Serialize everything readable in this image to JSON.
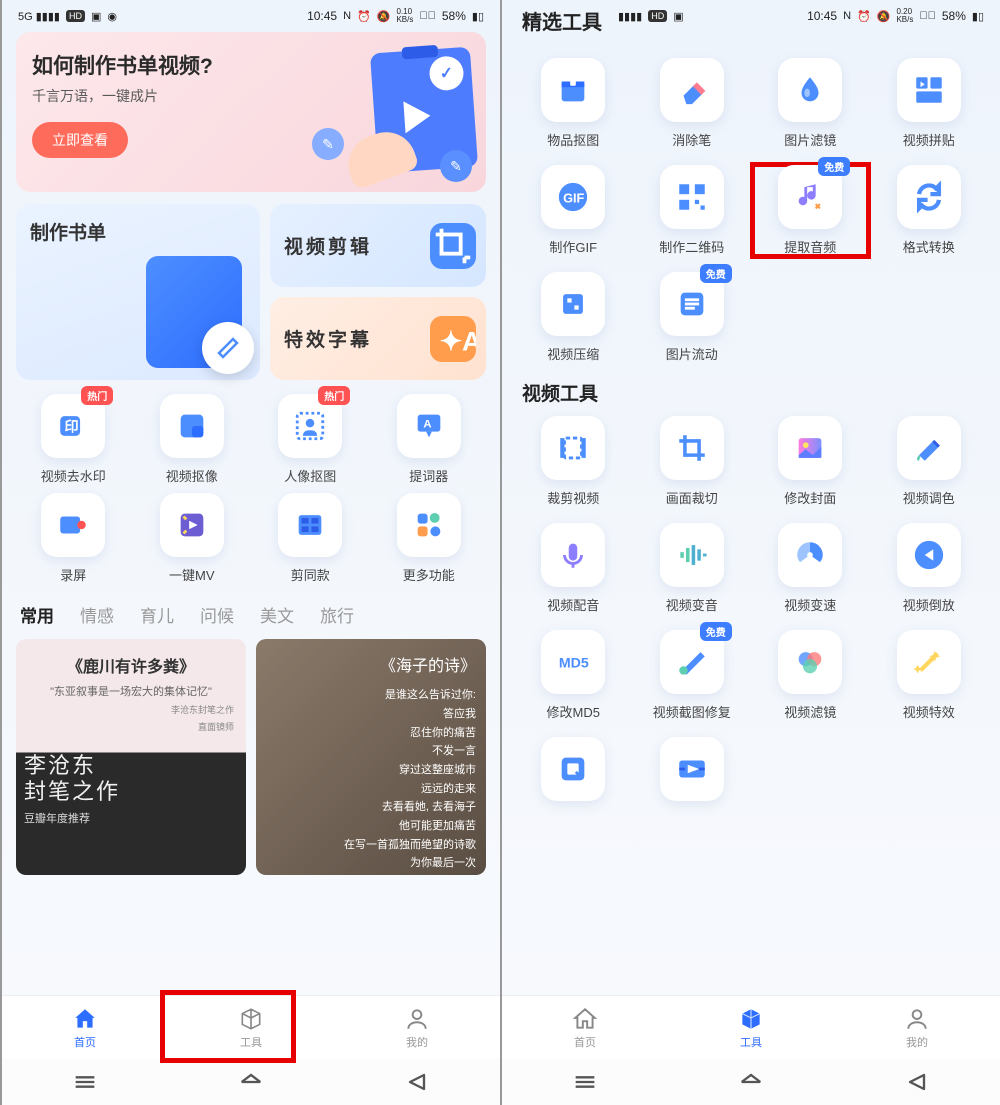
{
  "status": {
    "time": "10:45",
    "net_speed": "0.10",
    "net_unit": "KB/s",
    "battery": "58%",
    "net_speed2": "0.20"
  },
  "left": {
    "banner": {
      "title": "如何制作书单视频?",
      "sub": "千言万语，一键成片",
      "cta": "立即查看"
    },
    "big_card": "制作书单",
    "side_cards": [
      {
        "label": "视频剪辑"
      },
      {
        "label": "特效字幕"
      }
    ],
    "tools": [
      {
        "label": "视频去水印",
        "badge": "热门",
        "icon": "watermark"
      },
      {
        "label": "视频抠像",
        "icon": "cutout"
      },
      {
        "label": "人像抠图",
        "badge": "热门",
        "icon": "portrait"
      },
      {
        "label": "提词器",
        "icon": "teleprompter"
      },
      {
        "label": "录屏",
        "icon": "record"
      },
      {
        "label": "一键MV",
        "icon": "mv"
      },
      {
        "label": "剪同款",
        "icon": "film"
      },
      {
        "label": "更多功能",
        "icon": "more"
      }
    ],
    "cats": [
      "常用",
      "情感",
      "育儿",
      "问候",
      "美文",
      "旅行"
    ],
    "tpl1": {
      "title": "《鹿川有许多粪》",
      "quote": "\"东亚叙事是一场宏大的集体记忆\"",
      "sub1": "李沧东封笔之作",
      "sub2": "直面镜师",
      "author": "李沧东",
      "work": "封笔之作",
      "rec": "豆瓣年度推荐"
    },
    "tpl2": {
      "title": "《海子的诗》",
      "lines": [
        "是谁这么告诉过你:",
        "答应我",
        "忍住你的痛苦",
        "不发一言",
        "穿过这整座城市",
        "远远的走来",
        "去看看她, 去看海子",
        "他可能更加痛苦",
        "在写一首孤独而绝望的诗歌",
        "为你最后一次"
      ]
    }
  },
  "right": {
    "page_title": "精选工具",
    "section2": "视频工具",
    "tools1": [
      {
        "label": "物品抠图",
        "icon": "box"
      },
      {
        "label": "消除笔",
        "icon": "eraser"
      },
      {
        "label": "图片滤镜",
        "icon": "drop"
      },
      {
        "label": "视频拼贴",
        "icon": "collage"
      },
      {
        "label": "制作GIF",
        "icon": "gif"
      },
      {
        "label": "制作二维码",
        "icon": "qr"
      },
      {
        "label": "提取音频",
        "badge": "免费",
        "icon": "music",
        "hl": true
      },
      {
        "label": "格式转换",
        "icon": "convert"
      },
      {
        "label": "视频压缩",
        "icon": "compress"
      },
      {
        "label": "图片流动",
        "badge": "免费",
        "icon": "flow"
      }
    ],
    "tools2": [
      {
        "label": "裁剪视频",
        "icon": "trim"
      },
      {
        "label": "画面裁切",
        "icon": "crop"
      },
      {
        "label": "修改封面",
        "icon": "cover"
      },
      {
        "label": "视频调色",
        "icon": "color"
      },
      {
        "label": "视频配音",
        "icon": "dub"
      },
      {
        "label": "视频变音",
        "icon": "voice"
      },
      {
        "label": "视频变速",
        "icon": "speed"
      },
      {
        "label": "视频倒放",
        "icon": "reverse"
      },
      {
        "label": "修改MD5",
        "icon": "md5"
      },
      {
        "label": "视频截图修复",
        "badge": "免费",
        "icon": "repair"
      },
      {
        "label": "视频滤镜",
        "icon": "vfilter"
      },
      {
        "label": "视频特效",
        "icon": "fx"
      }
    ],
    "extra": [
      "",
      ""
    ]
  },
  "nav": [
    {
      "label": "首页",
      "icon": "home"
    },
    {
      "label": "工具",
      "icon": "tools"
    },
    {
      "label": "我的",
      "icon": "profile"
    }
  ],
  "colors": {
    "blue": "#3d7dff",
    "orange": "#ff9d4d",
    "red": "#ff5252"
  }
}
